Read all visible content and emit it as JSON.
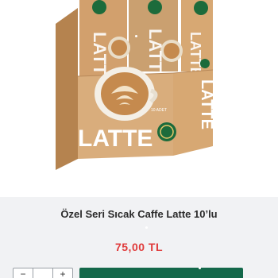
{
  "product": {
    "title": "Özel Seri Sıcak Caffe Latte 10’lu",
    "price": "75,00 TL"
  },
  "package": {
    "brand_text": "LATTE",
    "side_text": "LATTE",
    "sticks_text": "LATTE",
    "small_label": "10 ADET",
    "colors": {
      "box": "#d9ad7c",
      "box_dark": "#b5834f",
      "cup": "#f4efe6",
      "coffee": "#c58a4e",
      "logo": "#1c6b3b"
    }
  },
  "colors": {
    "price": "#e03b3b",
    "add_to_cart": "#14684a",
    "info_bg": "#f1f2f4"
  }
}
